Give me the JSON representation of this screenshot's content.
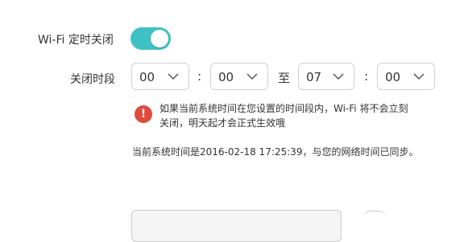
{
  "wifi_timer": {
    "label": "Wi-Fi 定时关闭",
    "enabled": true,
    "accent_color": "#3fc1c4"
  },
  "period": {
    "label": "关闭时段",
    "start_hour": "00",
    "start_minute": "00",
    "to_label": "至",
    "end_hour": "07",
    "end_minute": "00",
    "time_separator": ":",
    "dropdown_icon": "chevron-down-icon"
  },
  "warning": {
    "icon": "exclamation-icon",
    "icon_glyph": "!",
    "icon_color": "#e2483d",
    "text": "如果当前系统时间在您设置的时间段内，Wi-Fi 将不会立刻关闭，明天起才会正式生效哦"
  },
  "system_time_text": "当前系统时间是2016-02-18 17:25:39，与您的网络时间已同步。"
}
